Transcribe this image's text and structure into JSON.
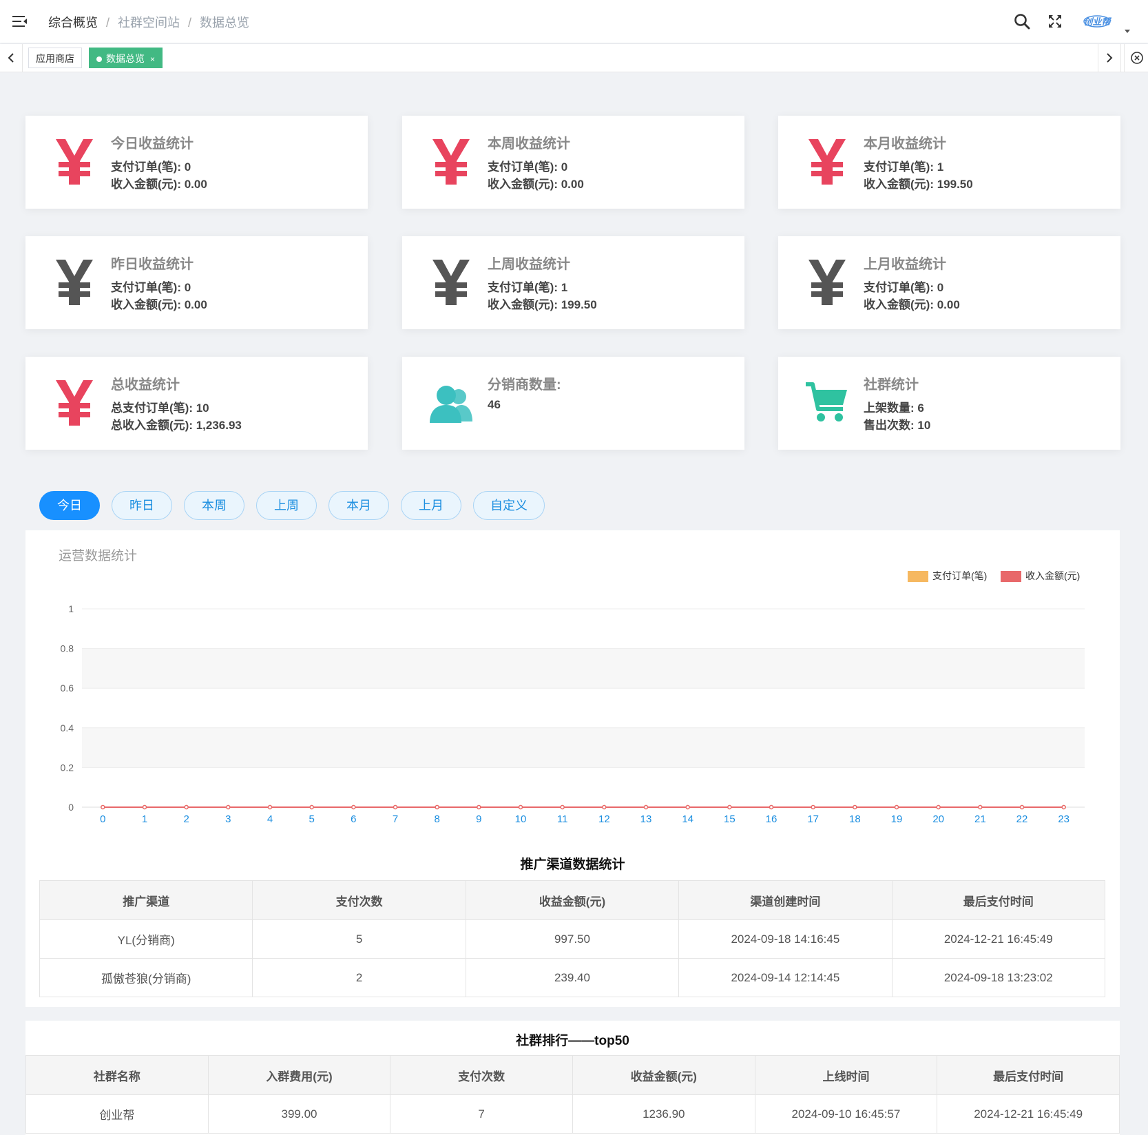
{
  "header": {
    "breadcrumb": [
      "综合概览",
      "社群空间站",
      "数据总览"
    ],
    "logo_text": "创业帮"
  },
  "tabs": [
    {
      "label": "应用商店"
    },
    {
      "label": "数据总览",
      "close": "×"
    }
  ],
  "stats": [
    {
      "title": "今日收益统计",
      "line1": "支付订单(笔): 0",
      "line2": "收入金额(元): 0.00",
      "icon": "yen-icon",
      "color": "#e8445e"
    },
    {
      "title": "本周收益统计",
      "line1": "支付订单(笔): 0",
      "line2": "收入金额(元): 0.00",
      "icon": "yen-icon",
      "color": "#e8445e"
    },
    {
      "title": "本月收益统计",
      "line1": "支付订单(笔): 1",
      "line2": "收入金额(元): 199.50",
      "icon": "yen-icon",
      "color": "#e8445e"
    },
    {
      "title": "昨日收益统计",
      "line1": "支付订单(笔): 0",
      "line2": "收入金额(元): 0.00",
      "icon": "yen-icon",
      "color": "#555555"
    },
    {
      "title": "上周收益统计",
      "line1": "支付订单(笔): 1",
      "line2": "收入金额(元): 199.50",
      "icon": "yen-icon",
      "color": "#555555"
    },
    {
      "title": "上月收益统计",
      "line1": "支付订单(笔): 0",
      "line2": "收入金额(元): 0.00",
      "icon": "yen-icon",
      "color": "#555555"
    },
    {
      "title": "总收益统计",
      "line1": "总支付订单(笔): 10",
      "line2": "总收入金额(元): 1,236.93",
      "icon": "yen-icon",
      "color": "#e8445e"
    },
    {
      "title": "分销商数量:",
      "line1": "46",
      "line2": "",
      "icon": "users-icon",
      "color": "#3cc0c0"
    },
    {
      "title": "社群统计",
      "line1": "上架数量: 6",
      "line2": "售出次数: 10",
      "icon": "cart-icon",
      "color": "#2fc2a0"
    }
  ],
  "filters": [
    "今日",
    "昨日",
    "本周",
    "上周",
    "本月",
    "上月",
    "自定义"
  ],
  "chart_title": "运营数据统计",
  "chart_data": {
    "type": "line",
    "title": "运营数据统计",
    "x": [
      0,
      1,
      2,
      3,
      4,
      5,
      6,
      7,
      8,
      9,
      10,
      11,
      12,
      13,
      14,
      15,
      16,
      17,
      18,
      19,
      20,
      21,
      22,
      23
    ],
    "ylim": [
      0,
      1
    ],
    "yticks": [
      "0",
      "0.2",
      "0.4",
      "0.6",
      "0.8",
      "1"
    ],
    "legend_position": "top-right",
    "series": [
      {
        "name": "支付订单(笔)",
        "color": "#f6b860",
        "values": [
          0,
          0,
          0,
          0,
          0,
          0,
          0,
          0,
          0,
          0,
          0,
          0,
          0,
          0,
          0,
          0,
          0,
          0,
          0,
          0,
          0,
          0,
          0,
          0
        ]
      },
      {
        "name": "收入金额(元)",
        "color": "#e8686a",
        "values": [
          0,
          0,
          0,
          0,
          0,
          0,
          0,
          0,
          0,
          0,
          0,
          0,
          0,
          0,
          0,
          0,
          0,
          0,
          0,
          0,
          0,
          0,
          0,
          0
        ]
      }
    ]
  },
  "channel_table": {
    "title": "推广渠道数据统计",
    "headers": [
      "推广渠道",
      "支付次数",
      "收益金额(元)",
      "渠道创建时间",
      "最后支付时间"
    ],
    "rows": [
      [
        "YL(分销商)",
        "5",
        "997.50",
        "2024-09-18 14:16:45",
        "2024-12-21 16:45:49"
      ],
      [
        "孤傲苍狼(分销商)",
        "2",
        "239.40",
        "2024-09-14 12:14:45",
        "2024-09-18 13:23:02"
      ]
    ]
  },
  "rank_table": {
    "title": "社群排行——top50",
    "headers": [
      "社群名称",
      "入群费用(元)",
      "支付次数",
      "收益金额(元)",
      "上线时间",
      "最后支付时间"
    ],
    "rows": [
      [
        "创业帮",
        "399.00",
        "7",
        "1236.90",
        "2024-09-10 16:45:57",
        "2024-12-21 16:45:49"
      ]
    ]
  }
}
